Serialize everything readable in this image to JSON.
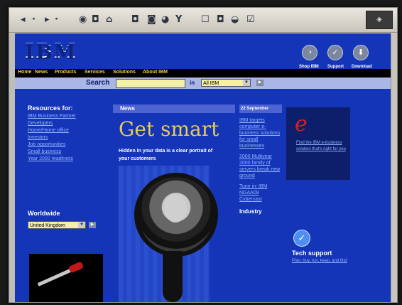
{
  "toolbar": {
    "icons": [
      "back-icon",
      "forward-icon",
      "stop-icon",
      "refresh-icon",
      "home-icon",
      "search-icon",
      "favorites-icon",
      "history-icon",
      "channels-icon",
      "fullscreen-icon",
      "mail-icon",
      "print-icon",
      "edit-icon"
    ]
  },
  "header": {
    "logo": "IBM",
    "icons": [
      {
        "label": "Shop IBM"
      },
      {
        "label": "Support"
      },
      {
        "label": "Download"
      }
    ]
  },
  "nav": {
    "items": [
      "Home",
      "News",
      "Products",
      "Services",
      "Solutions",
      "About IBM"
    ]
  },
  "search": {
    "label": "Search",
    "in_label": "in",
    "scope": "All IBM"
  },
  "resources": {
    "title": "Resources for:",
    "items": [
      "IBM Business Partner",
      "Developers",
      "Home/Home office",
      "Investors",
      "Job opportunities",
      "Small business",
      "Year 2000 readiness"
    ]
  },
  "worldwide": {
    "title": "Worldwide",
    "country": "United Kingdom"
  },
  "news": {
    "header": "News",
    "headline": "Get smart",
    "subhead": "Hidden in your data is a clear portrait of your customers"
  },
  "news_col": {
    "date": "22 September",
    "links": [
      "IBM targets computer e-business solutions for small businesses",
      "2000 Multiyear 2000 family of servers break new ground",
      "Tune in: IBM NGAA08 Cybercast"
    ],
    "industry": "Industry"
  },
  "ebiz": {
    "logo": "e",
    "text": "Find the IBM e-business solution that's right for you"
  },
  "tech": {
    "title": "Tech support",
    "text": "Plan, buy, run, keep, and find"
  }
}
